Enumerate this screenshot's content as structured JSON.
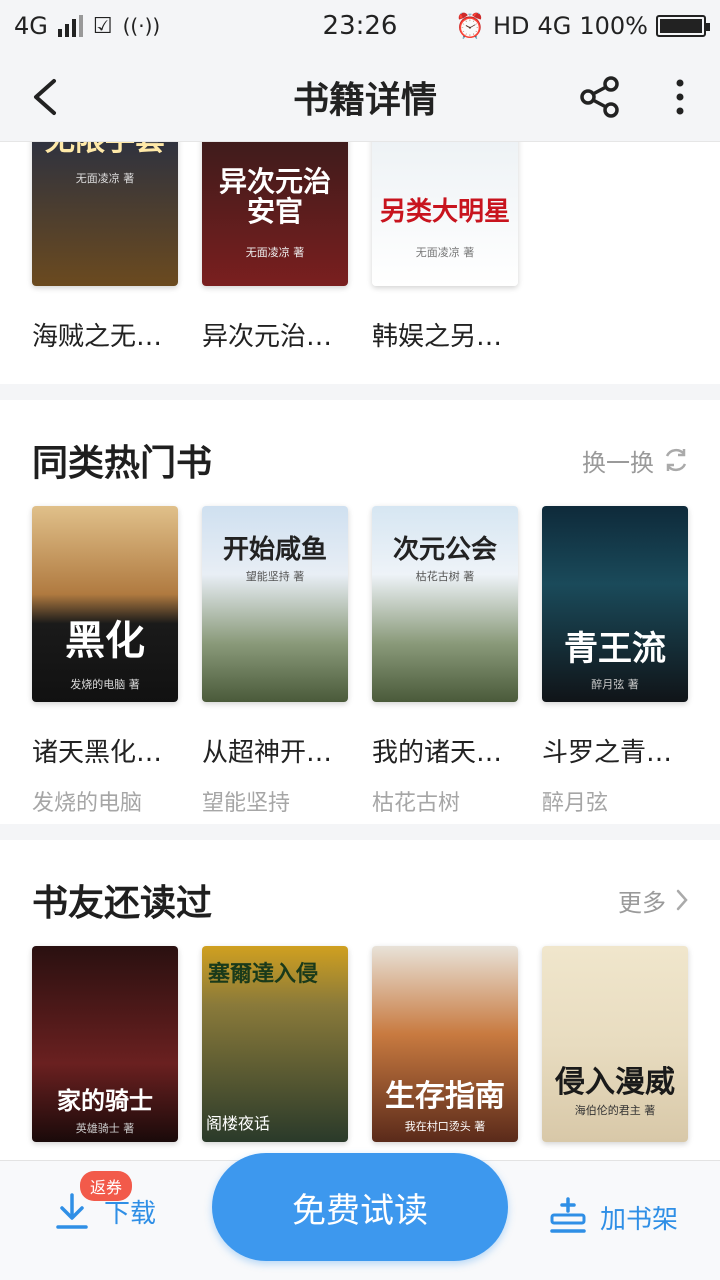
{
  "status_bar": {
    "network": "4G",
    "time": "23:26",
    "hd": "HD",
    "network2": "4G",
    "battery": "100%"
  },
  "header": {
    "title": "书籍详情"
  },
  "top_row": [
    {
      "cover_title": "无限手套",
      "cover_author": "无面凌凉 著",
      "name": "海贼之无…",
      "colors": [
        "#1a2a4a",
        "#6b4a1f"
      ]
    },
    {
      "cover_title": "异次元治安官",
      "cover_author": "无面凌凉 著",
      "name": "异次元治…",
      "colors": [
        "#2a1a1a",
        "#7a1f1f"
      ]
    },
    {
      "cover_title": "另类大明星",
      "cover_author": "无面凌凉 著",
      "name": "韩娱之另…",
      "colors": [
        "#e8eef2",
        "#ffffff"
      ]
    }
  ],
  "similar": {
    "title": "同类热门书",
    "action": "换一换",
    "books": [
      {
        "cover_title": "黑化",
        "cover_author": "发烧的电脑 著",
        "name": "诸天黑化…",
        "author": "发烧的电脑",
        "colors": [
          "#e0c08a",
          "#1a1a1a"
        ]
      },
      {
        "cover_title": "开始咸鱼",
        "cover_author": "望能坚持 著",
        "name": "从超神开…",
        "author": "望能坚持",
        "colors": [
          "#cfe0f0",
          "#6b7f5a"
        ]
      },
      {
        "cover_title": "次元公会",
        "cover_author": "枯花古树 著",
        "name": "我的诸天…",
        "author": "枯花古树",
        "colors": [
          "#d6e6f2",
          "#6b7f5a"
        ]
      },
      {
        "cover_title": "青王流",
        "cover_author": "醉月弦 著",
        "name": "斗罗之青…",
        "author": "醉月弦",
        "colors": [
          "#0e2a3a",
          "#101418"
        ]
      }
    ]
  },
  "also_read": {
    "title": "书友还读过",
    "action": "更多",
    "books": [
      {
        "cover_title": "家的骑士",
        "cover_author": "英雄骑士 著",
        "colors": [
          "#2a1010",
          "#6a2020"
        ]
      },
      {
        "cover_title": "塞爾達入侵",
        "cover_author": "阁楼夜话",
        "colors": [
          "#d0a020",
          "#2a3a2a"
        ]
      },
      {
        "cover_title": "生存指南",
        "cover_author": "我在村口烫头 著",
        "colors": [
          "#e8e2d8",
          "#a04020"
        ]
      },
      {
        "cover_title": "侵入漫威",
        "cover_author": "海伯伦的君主 著",
        "colors": [
          "#f0e6cc",
          "#d8c8a8"
        ]
      }
    ]
  },
  "bottom_bar": {
    "badge": "返券",
    "download": "下载",
    "read": "免费试读",
    "shelf": "加书架"
  }
}
